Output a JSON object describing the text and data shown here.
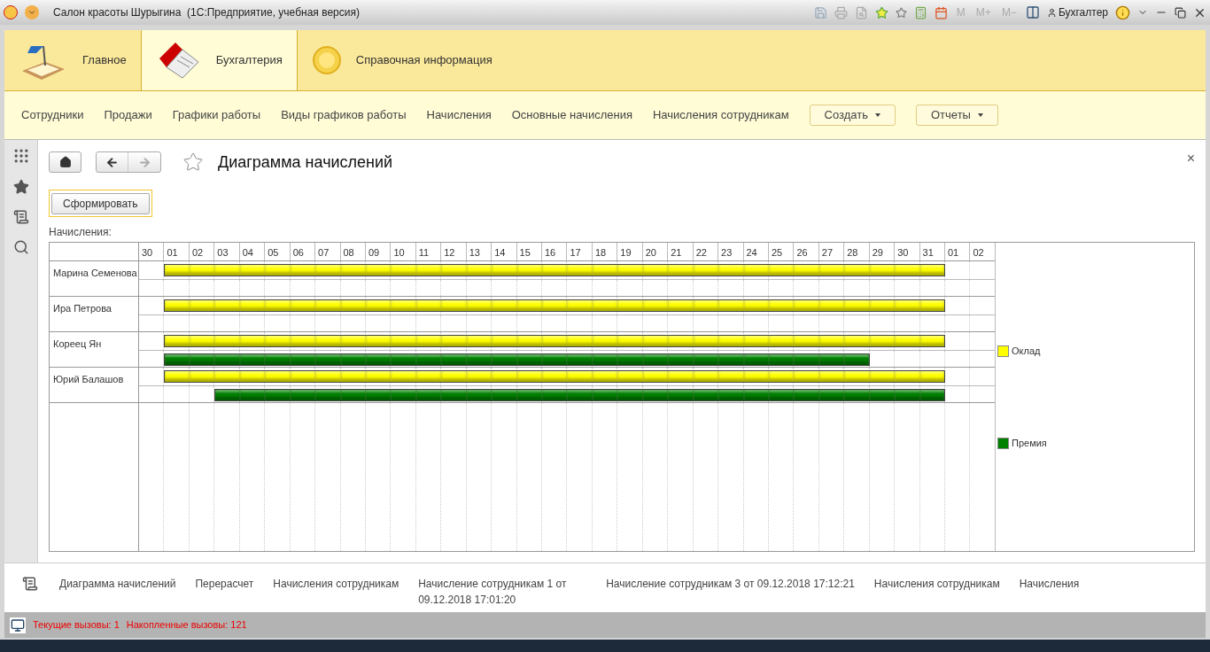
{
  "window": {
    "title": "Салон красоты Шурыгина  (1С:Предприятие, учебная версия)",
    "toolbar": [
      "M",
      "M+",
      "M−"
    ],
    "user": "Бухгалтер"
  },
  "sections": [
    {
      "label": "Главное",
      "selected": false,
      "kind": "desk"
    },
    {
      "label": "Бухгалтерия",
      "selected": true,
      "kind": "book"
    },
    {
      "label": "Справочная информация",
      "selected": false,
      "kind": "orb"
    }
  ],
  "nav": {
    "links": [
      "Сотрудники",
      "Продажи",
      "Графики работы",
      "Виды графиков работы",
      "Начисления",
      "Основные начисления",
      "Начисления сотрудникам"
    ],
    "menus": [
      "Создать",
      "Отчеты"
    ]
  },
  "form": {
    "title": "Диаграмма начислений",
    "close": "×",
    "generate_button": "Сформировать",
    "chart_label": "Начисления:"
  },
  "gantt": {
    "days": [
      "30",
      "01",
      "02",
      "03",
      "04",
      "05",
      "06",
      "07",
      "08",
      "09",
      "10",
      "11",
      "12",
      "13",
      "14",
      "15",
      "16",
      "17",
      "18",
      "19",
      "20",
      "21",
      "22",
      "23",
      "24",
      "25",
      "26",
      "27",
      "28",
      "29",
      "30",
      "31",
      "01",
      "02"
    ],
    "rows": [
      {
        "name": "Марина Семенова",
        "lanes": [
          {
            "color": "#ffff00",
            "cover": [
              false,
              true,
              true,
              true,
              true,
              true,
              true,
              true,
              true,
              true,
              true,
              true,
              true,
              true,
              true,
              true,
              true,
              true,
              true,
              true,
              true,
              true,
              true,
              true,
              true,
              true,
              true,
              true,
              true,
              true,
              true,
              true,
              false,
              false
            ]
          }
        ]
      },
      {
        "name": "Ира Петрова",
        "lanes": [
          {
            "color": "#ffff00",
            "cover": [
              false,
              true,
              true,
              true,
              true,
              true,
              true,
              true,
              true,
              true,
              true,
              true,
              true,
              true,
              true,
              true,
              true,
              true,
              true,
              true,
              true,
              true,
              true,
              true,
              true,
              true,
              true,
              true,
              true,
              true,
              true,
              true,
              false,
              false
            ]
          }
        ]
      },
      {
        "name": "Кореец Ян",
        "lanes": [
          {
            "color": "#ffff00",
            "cover": [
              false,
              true,
              true,
              true,
              true,
              true,
              true,
              true,
              true,
              true,
              true,
              true,
              true,
              true,
              true,
              true,
              true,
              true,
              true,
              true,
              true,
              true,
              true,
              true,
              true,
              true,
              true,
              true,
              true,
              true,
              true,
              true,
              false,
              false
            ]
          },
          {
            "color": "#008000",
            "cover": [
              false,
              true,
              true,
              true,
              true,
              true,
              true,
              true,
              true,
              true,
              true,
              true,
              true,
              true,
              true,
              true,
              true,
              true,
              true,
              true,
              true,
              true,
              true,
              true,
              true,
              true,
              true,
              true,
              true,
              false,
              false,
              false,
              false,
              false
            ]
          }
        ]
      },
      {
        "name": "Юрий Балашов",
        "lanes": [
          {
            "color": "#ffff00",
            "cover": [
              false,
              true,
              true,
              true,
              true,
              true,
              true,
              true,
              true,
              true,
              true,
              true,
              true,
              true,
              true,
              true,
              true,
              true,
              true,
              true,
              true,
              true,
              true,
              true,
              true,
              true,
              true,
              true,
              true,
              true,
              true,
              true,
              false,
              false
            ]
          },
          {
            "color": "#008000",
            "cover": [
              false,
              false,
              false,
              true,
              true,
              true,
              true,
              true,
              true,
              true,
              true,
              true,
              true,
              true,
              true,
              true,
              true,
              true,
              true,
              true,
              true,
              true,
              true,
              true,
              true,
              true,
              true,
              true,
              true,
              true,
              true,
              true,
              false,
              false
            ]
          }
        ]
      }
    ],
    "legend": [
      {
        "label": "Оклад",
        "color": "#ffff00"
      },
      {
        "label": "Премия",
        "color": "#008000"
      }
    ]
  },
  "history": [
    "Диаграмма начислений",
    "Перерасчет",
    "Начисления сотрудникам",
    "Начисление сотрудникам 1 от 09.12.2018 17:01:20",
    "Начисление сотрудникам 3 от 09.12.2018 17:12:21",
    "Начисления сотрудникам",
    "Начисления"
  ],
  "status": {
    "current": "Текущие вызовы: 1",
    "accumulated": "Накопленные вызовы: 121"
  }
}
